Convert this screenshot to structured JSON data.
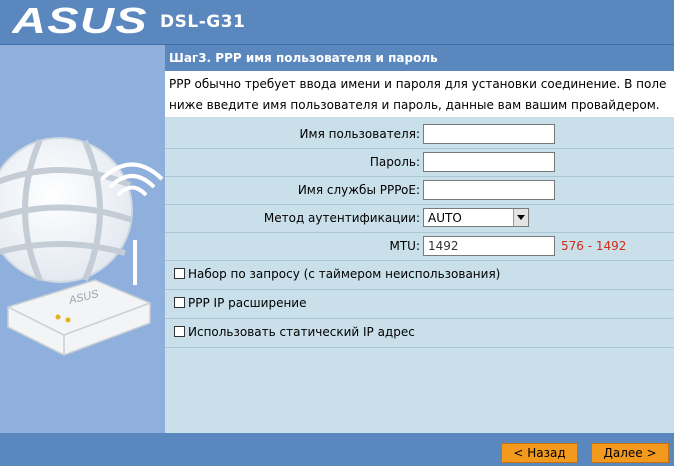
{
  "header": {
    "brand": "ASUS",
    "model": "DSL-G31"
  },
  "main": {
    "title": "Шаг3. PPP имя пользователя и пароль",
    "description": "PPP обычно требует ввода имени и пароля для установки соединение. В поле ниже введите имя пользователя и пароль, данные вам вашим провайдером.",
    "username_label": "Имя пользователя:",
    "username_value": "",
    "password_label": "Пароль:",
    "password_value": "",
    "service_label": "Имя службы PPPoE:",
    "service_value": "",
    "auth_label": "Метод аутентификации:",
    "auth_value": "AUTO",
    "mtu_label": "MTU:",
    "mtu_value": "1492",
    "mtu_range": "576 - 1492",
    "dial_on_demand": "Набор по запросу (с таймером неиспользования)",
    "ppp_ip_extension": "PPP IP расширение",
    "static_ip": "Использовать статический IP адрес"
  },
  "footer": {
    "back": "< Назад",
    "next": "Далее >"
  },
  "colors": {
    "header": "#5b87bf",
    "content": "#c9e0ea",
    "button": "#f39a1e",
    "range": "#d32b16"
  }
}
